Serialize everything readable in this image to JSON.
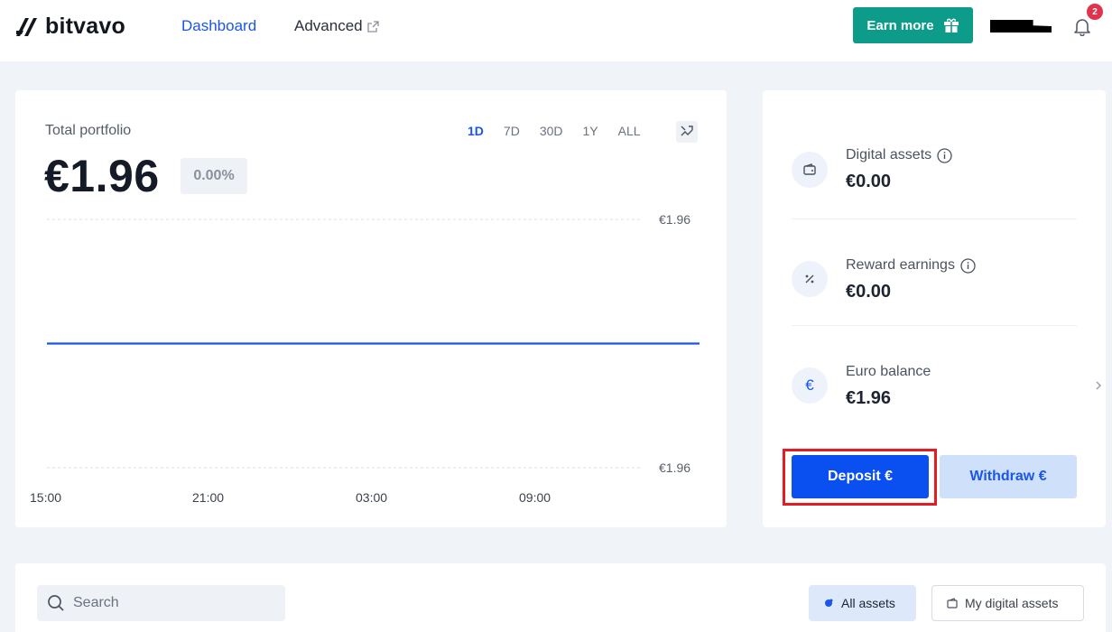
{
  "header": {
    "logo_text": "bitvavo",
    "nav": [
      {
        "label": "Dashboard",
        "active": true
      },
      {
        "label": "Advanced",
        "active": false
      }
    ],
    "earn_label": "Earn more",
    "notification_count": "2",
    "accent_color": "#1a56e8",
    "earn_color": "#0e9c8a"
  },
  "portfolio": {
    "label": "Total portfolio",
    "value": "€1.96",
    "change": "0.00%",
    "range_tabs": [
      "1D",
      "7D",
      "30D",
      "1Y",
      "ALL"
    ],
    "active_range": "1D"
  },
  "chart_data": {
    "type": "line",
    "x": [
      "15:00",
      "21:00",
      "03:00",
      "09:00"
    ],
    "series": [
      {
        "values": [
          1.96,
          1.96,
          1.96,
          1.96,
          1.96
        ]
      }
    ],
    "y_ticks": [
      "€1.96",
      "€1.96"
    ],
    "ylim": [
      1.96,
      1.96
    ],
    "grid": true,
    "color": "#1a56e8"
  },
  "balances": {
    "rows": [
      {
        "label": "Digital assets",
        "value": "€0.00",
        "icon": "wallet-icon",
        "info": true
      },
      {
        "label": "Reward earnings",
        "value": "€0.00",
        "icon": "percent-icon",
        "info": true
      },
      {
        "label": "Euro balance",
        "value": "€1.96",
        "icon": "euro-icon",
        "info": false,
        "chevron": true
      }
    ],
    "euro_symbol": "€",
    "deposit_label": "Deposit €",
    "withdraw_label": "Withdraw €"
  },
  "assets": {
    "search_placeholder": "Search",
    "filters": [
      {
        "label": "All assets",
        "active": true
      },
      {
        "label": "My digital assets",
        "active": false
      }
    ]
  }
}
